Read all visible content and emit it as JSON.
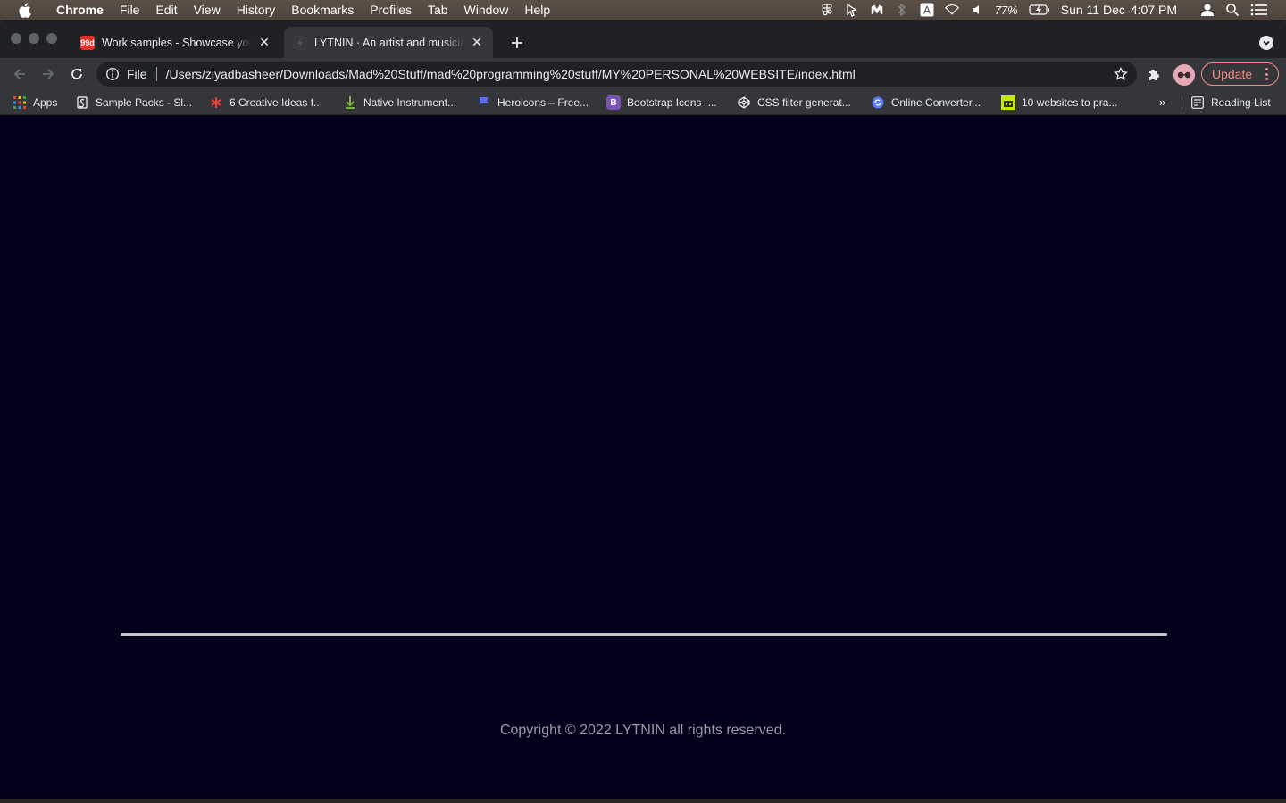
{
  "menubar": {
    "app_name": "Chrome",
    "items": [
      "File",
      "Edit",
      "View",
      "History",
      "Bookmarks",
      "Profiles",
      "Tab",
      "Window",
      "Help"
    ],
    "battery": "77%",
    "date": "Sun 11 Dec",
    "time": "4:07 PM",
    "status_icons": [
      "figma-icon",
      "cursor-icon",
      "malwarebytes-icon",
      "bluetooth-icon",
      "input-source-icon",
      "wifi-icon",
      "volume-icon",
      "battery-icon",
      "user-icon",
      "spotlight-icon",
      "control-center-icon"
    ]
  },
  "tabs": [
    {
      "title": "Work samples - Showcase your",
      "favicon": "99designs-icon",
      "favicon_color": "#e0332a",
      "favicon_text": "99d",
      "active": false
    },
    {
      "title": "LYTNIN · An artist and musician",
      "favicon": "lytnin-icon",
      "favicon_color": "#3a3b3f",
      "favicon_text": "",
      "active": true
    }
  ],
  "toolbar": {
    "scheme": "File",
    "url": "/Users/ziyadbasheer/Downloads/Mad%20Stuff/mad%20programming%20stuff/MY%20PERSONAL%20WEBSITE/index.html",
    "update_label": "Update"
  },
  "bookmarks": {
    "items": [
      {
        "label": "Apps",
        "icon": "apps-grid-icon",
        "color": "#4285f4"
      },
      {
        "label": "Sample Packs - Sl...",
        "icon": "splice-icon",
        "color": "#ffffff"
      },
      {
        "label": "6 Creative Ideas f...",
        "icon": "asterisk-icon",
        "color": "#ea4335"
      },
      {
        "label": "Native Instrument...",
        "icon": "download-arrow-icon",
        "color": "#7cb342"
      },
      {
        "label": "Heroicons – Free...",
        "icon": "flag-icon",
        "color": "#5b6cff"
      },
      {
        "label": "Bootstrap Icons ·...",
        "icon": "bootstrap-icon",
        "color": "#7952b3"
      },
      {
        "label": "CSS filter generat...",
        "icon": "codepen-icon",
        "color": "#ffffff"
      },
      {
        "label": "Online Converter...",
        "icon": "converter-icon",
        "color": "#5b7cfa"
      },
      {
        "label": "10 websites to pra...",
        "icon": "green-square-icon",
        "color": "#c6e80a"
      }
    ],
    "more": "»",
    "reading_list": "Reading List"
  },
  "page": {
    "copyright": "Copyright © 2022 LYTNIN all rights reserved."
  }
}
